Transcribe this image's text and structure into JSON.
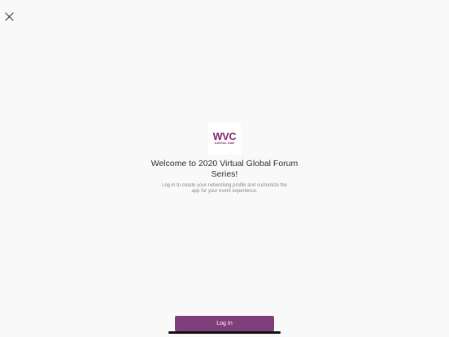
{
  "header": {
    "close_icon": "close-icon"
  },
  "logo": {
    "main_text": "WVC",
    "sub_text": "DIGITAL HUB",
    "brand_color": "#7b2566"
  },
  "welcome": {
    "title": "Welcome to 2020 Virtual Global Forum Series!",
    "subtitle": "Log in to create your networking profile and customize the app for your event experience."
  },
  "actions": {
    "login_label": "Log In",
    "login_color": "#7f3f7b"
  }
}
